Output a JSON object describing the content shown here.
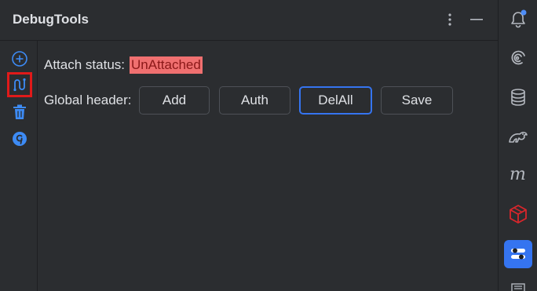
{
  "window": {
    "title": "DebugTools"
  },
  "header_actions": [
    {
      "name": "more-options-icon",
      "glyph": "⋮"
    },
    {
      "name": "minimize-icon",
      "glyph": "—"
    }
  ],
  "left_toolbar": [
    {
      "name": "add-icon",
      "selected": false
    },
    {
      "name": "attach-icon",
      "selected": true
    },
    {
      "name": "trash-icon",
      "selected": false
    },
    {
      "name": "groovy-icon",
      "selected": false
    }
  ],
  "attach": {
    "label": "Attach status:",
    "status": "UnAttached",
    "status_color": "#f07070"
  },
  "global_header": {
    "label": "Global header:",
    "buttons": [
      {
        "label": "Add",
        "focused": false
      },
      {
        "label": "Auth",
        "focused": false
      },
      {
        "label": "DelAll",
        "focused": true
      },
      {
        "label": "Save",
        "focused": false
      }
    ]
  },
  "right_toolbar": [
    {
      "name": "notifications-icon"
    },
    {
      "name": "swirl-icon"
    },
    {
      "name": "database-icon"
    },
    {
      "name": "gradle-icon"
    },
    {
      "name": "maven-icon"
    },
    {
      "name": "cube-icon"
    },
    {
      "name": "debugtools-icon",
      "active": true
    },
    {
      "name": "document-icon"
    }
  ],
  "colors": {
    "accent": "#3574f0",
    "icon_blue": "#3d8bf5",
    "selection_red": "#e01a1a",
    "notification_dot": "#4f8ef7",
    "cube_red": "#d9262b"
  }
}
